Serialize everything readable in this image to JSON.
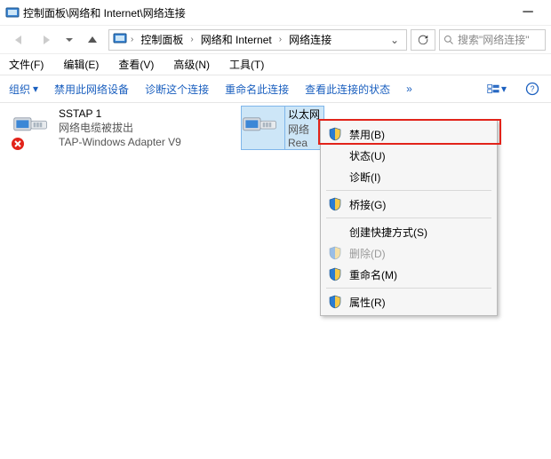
{
  "title": "控制面板\\网络和 Internet\\网络连接",
  "breadcrumbs": {
    "b0": "控制面板",
    "b1": "网络和 Internet",
    "b2": "网络连接"
  },
  "search": {
    "placeholder": "搜索\"网络连接\""
  },
  "menus": {
    "file": "文件(F)",
    "edit": "编辑(E)",
    "view": "查看(V)",
    "advanced": "高级(N)",
    "tools": "工具(T)"
  },
  "cmdbar": {
    "organize": "组织",
    "disable": "禁用此网络设备",
    "diagnose": "诊断这个连接",
    "rename": "重命名此连接",
    "status": "查看此连接的状态",
    "more": "»"
  },
  "adapters": {
    "a0": {
      "name": "SSTAP 1",
      "status": "网络电缆被拔出",
      "device": "TAP-Windows Adapter V9"
    },
    "a1": {
      "name": "以太网",
      "status": "网络",
      "device": "Rea"
    }
  },
  "context": {
    "disable": "禁用(B)",
    "status": "状态(U)",
    "diagnose": "诊断(I)",
    "bridge": "桥接(G)",
    "shortcut": "创建快捷方式(S)",
    "delete": "删除(D)",
    "rename": "重命名(M)",
    "properties": "属性(R)"
  }
}
